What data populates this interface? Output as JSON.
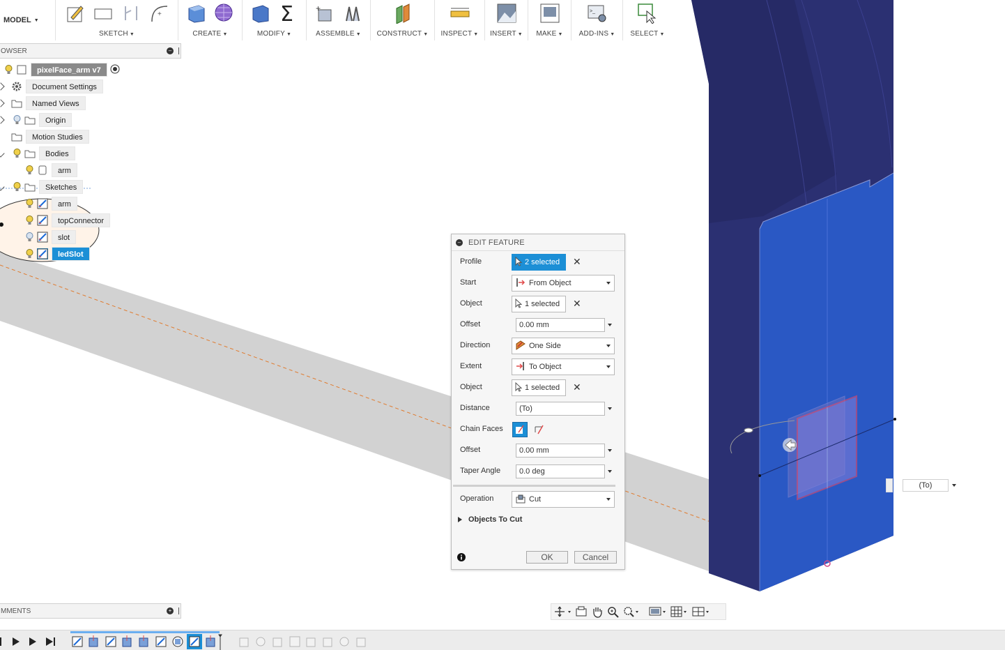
{
  "toolbar": {
    "workspace": "MODEL",
    "groups": [
      {
        "label": "SKETCH",
        "icons": [
          "create-sketch-icon",
          "rectangle-icon",
          "sketch-dimension-icon",
          "arc-icon"
        ]
      },
      {
        "label": "CREATE",
        "icons": [
          "extrude-icon",
          "sphere-icon"
        ]
      },
      {
        "label": "MODIFY",
        "icons": [
          "press-pull-icon",
          "sigma-icon"
        ]
      },
      {
        "label": "ASSEMBLE",
        "icons": [
          "new-component-icon",
          "joint-icon"
        ]
      },
      {
        "label": "CONSTRUCT",
        "icons": [
          "offset-plane-icon"
        ]
      },
      {
        "label": "INSPECT",
        "icons": [
          "measure-icon"
        ]
      },
      {
        "label": "INSERT",
        "icons": [
          "insert-image-icon"
        ]
      },
      {
        "label": "MAKE",
        "icons": [
          "print-3d-icon"
        ]
      },
      {
        "label": "ADD-INS",
        "icons": [
          "scripts-icon"
        ]
      },
      {
        "label": "SELECT",
        "icons": [
          "select-arrow-icon"
        ]
      }
    ]
  },
  "browser": {
    "title": "OWSER",
    "root": "pixelFace_arm v7",
    "items": [
      {
        "label": "Document Settings",
        "icon": "gear-icon"
      },
      {
        "label": "Named Views",
        "icon": "folder-icon"
      },
      {
        "label": "Origin",
        "icon": "folder-icon"
      },
      {
        "label": "Motion Studies",
        "icon": "folder-icon"
      },
      {
        "label": "Bodies",
        "icon": "folder-icon"
      },
      {
        "label": "arm",
        "icon": "body-icon"
      },
      {
        "label": "Sketches",
        "icon": "folder-icon"
      },
      {
        "label": "arm",
        "icon": "sketch-icon"
      },
      {
        "label": "topConnector",
        "icon": "sketch-icon"
      },
      {
        "label": "slot",
        "icon": "sketch-icon"
      },
      {
        "label": "ledSlot",
        "icon": "sketch-icon"
      }
    ]
  },
  "comments": {
    "title": "MMENTS"
  },
  "edit_feature": {
    "title": "EDIT FEATURE",
    "profile": {
      "label": "Profile",
      "value": "2 selected"
    },
    "start": {
      "label": "Start",
      "value": "From Object"
    },
    "object1": {
      "label": "Object",
      "value": "1 selected"
    },
    "offset1": {
      "label": "Offset",
      "value": "0.00 mm"
    },
    "direction": {
      "label": "Direction",
      "value": "One Side"
    },
    "extent": {
      "label": "Extent",
      "value": "To Object"
    },
    "object2": {
      "label": "Object",
      "value": "1 selected"
    },
    "distance": {
      "label": "Distance",
      "value": "(To)"
    },
    "chain_faces": {
      "label": "Chain Faces"
    },
    "offset2": {
      "label": "Offset",
      "value": "0.00 mm"
    },
    "taper": {
      "label": "Taper Angle",
      "value": "0.0 deg"
    },
    "operation": {
      "label": "Operation",
      "value": "Cut"
    },
    "objects_to_cut": {
      "label": "Objects To Cut"
    },
    "ok": "OK",
    "cancel": "Cancel"
  },
  "float_distance": {
    "value": "(To)"
  },
  "colors": {
    "accent": "#1c8fd6",
    "body_dark": "#2b3072",
    "body_blue": "#2a58c4"
  }
}
